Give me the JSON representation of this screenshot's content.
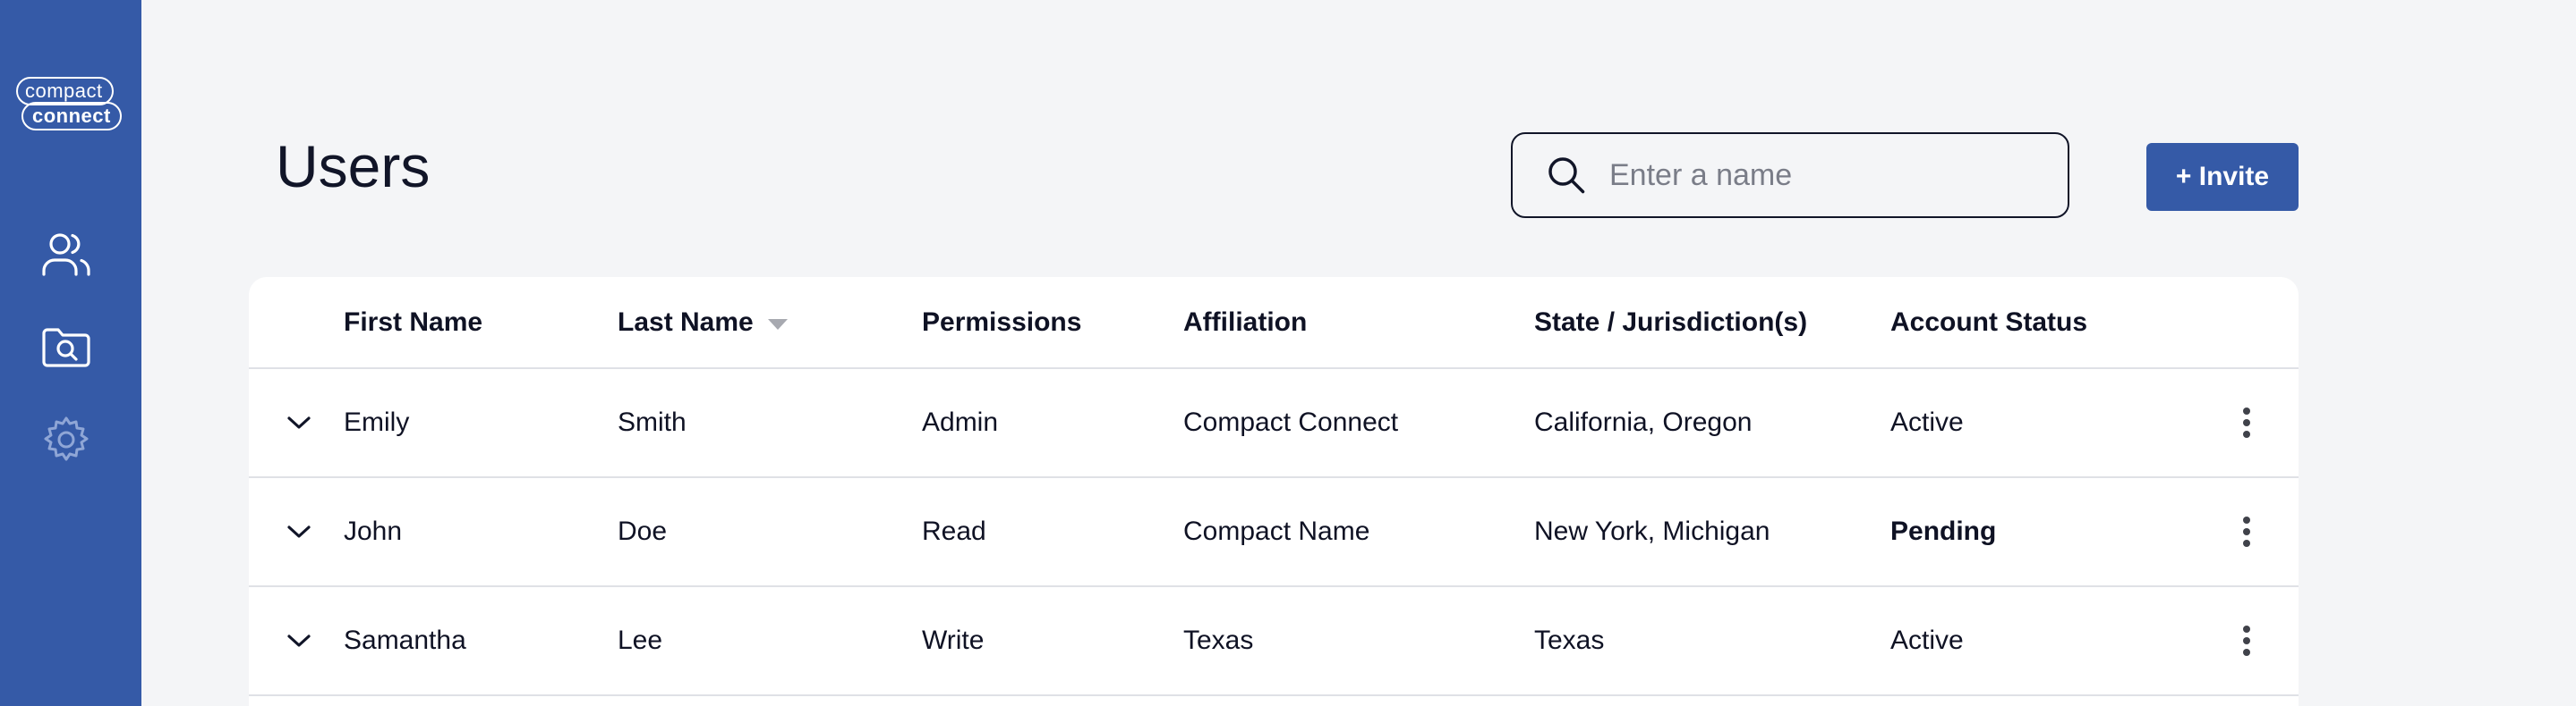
{
  "app": {
    "logo_top": "compact",
    "logo_bottom": "connect",
    "accent_color": "#355aa7"
  },
  "sidebar": {
    "items": [
      {
        "icon": "users-icon"
      },
      {
        "icon": "search-folder-icon"
      },
      {
        "icon": "gear-icon"
      }
    ]
  },
  "page": {
    "title": "Users"
  },
  "search": {
    "placeholder": "Enter a name",
    "value": ""
  },
  "toolbar": {
    "invite_label": "+ Invite"
  },
  "table": {
    "columns": [
      "First Name",
      "Last Name",
      "Permissions",
      "Affiliation",
      "State / Jurisdiction(s)",
      "Account Status"
    ],
    "sorted_column": "Last Name",
    "sort_direction": "descending",
    "rows": [
      {
        "first": "Emily",
        "last": "Smith",
        "permissions": "Admin",
        "affiliation": "Compact Connect",
        "states": "California, Oregon",
        "status": "Active"
      },
      {
        "first": "John",
        "last": "Doe",
        "permissions": "Read",
        "affiliation": "Compact Name",
        "states": "New York, Michigan",
        "status": "Pending"
      },
      {
        "first": "Samantha",
        "last": "Lee",
        "permissions": "Write",
        "affiliation": "Texas",
        "states": "Texas",
        "status": "Active"
      }
    ]
  }
}
